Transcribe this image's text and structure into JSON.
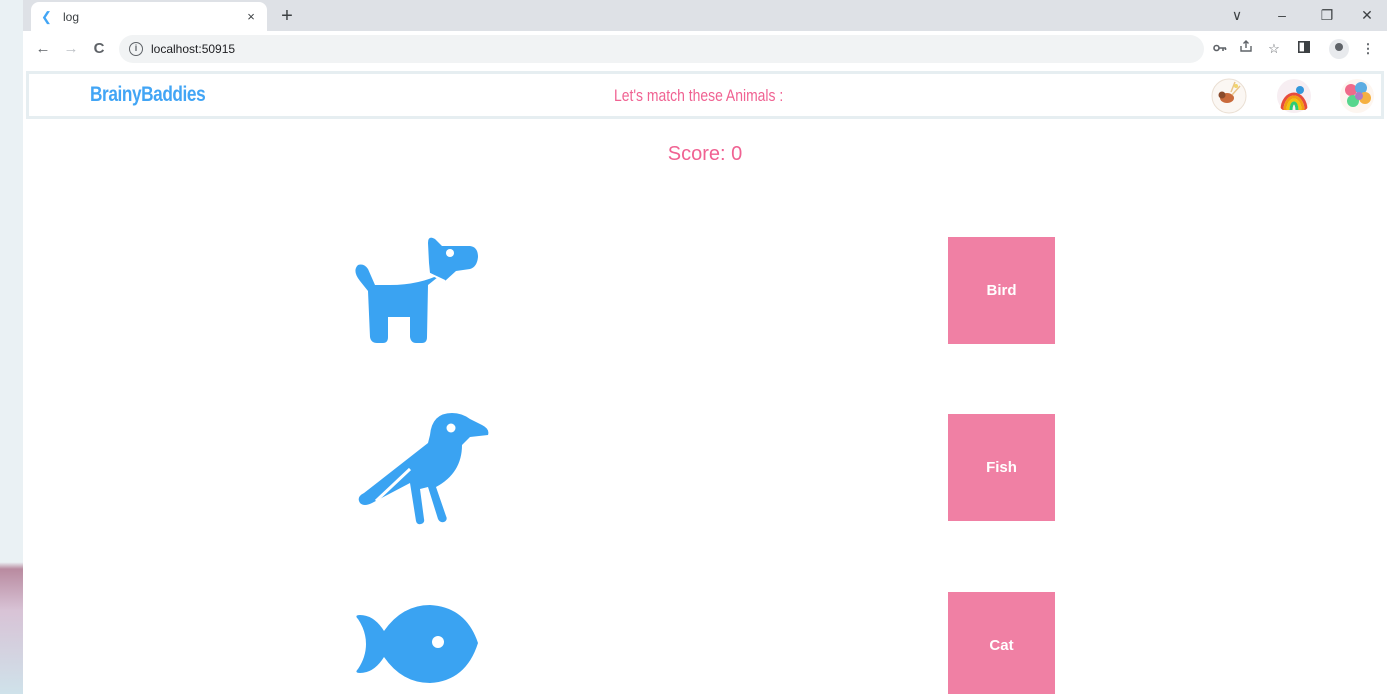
{
  "browser": {
    "tab_title": "log",
    "tab_close": "×",
    "new_tab": "+",
    "url": "localhost:50915",
    "window_controls": [
      "∨",
      "–",
      "❐",
      "✕"
    ],
    "nav": {
      "back": "←",
      "forward": "→",
      "reload": "C"
    }
  },
  "app": {
    "brand": "BrainyBaddies",
    "headline": "Let's match these Animals :",
    "score": "Score: 0",
    "animals": [
      {
        "icon": "dog-icon"
      },
      {
        "icon": "bird-icon"
      },
      {
        "icon": "fish-icon"
      }
    ],
    "targets": [
      {
        "label": "Bird"
      },
      {
        "label": "Fish"
      },
      {
        "label": "Cat"
      }
    ]
  },
  "colors": {
    "accent_blue": "#42a5f5",
    "accent_pink": "#f06292",
    "tile_pink": "#f080a4",
    "icon_blue": "#3aa3f2"
  }
}
